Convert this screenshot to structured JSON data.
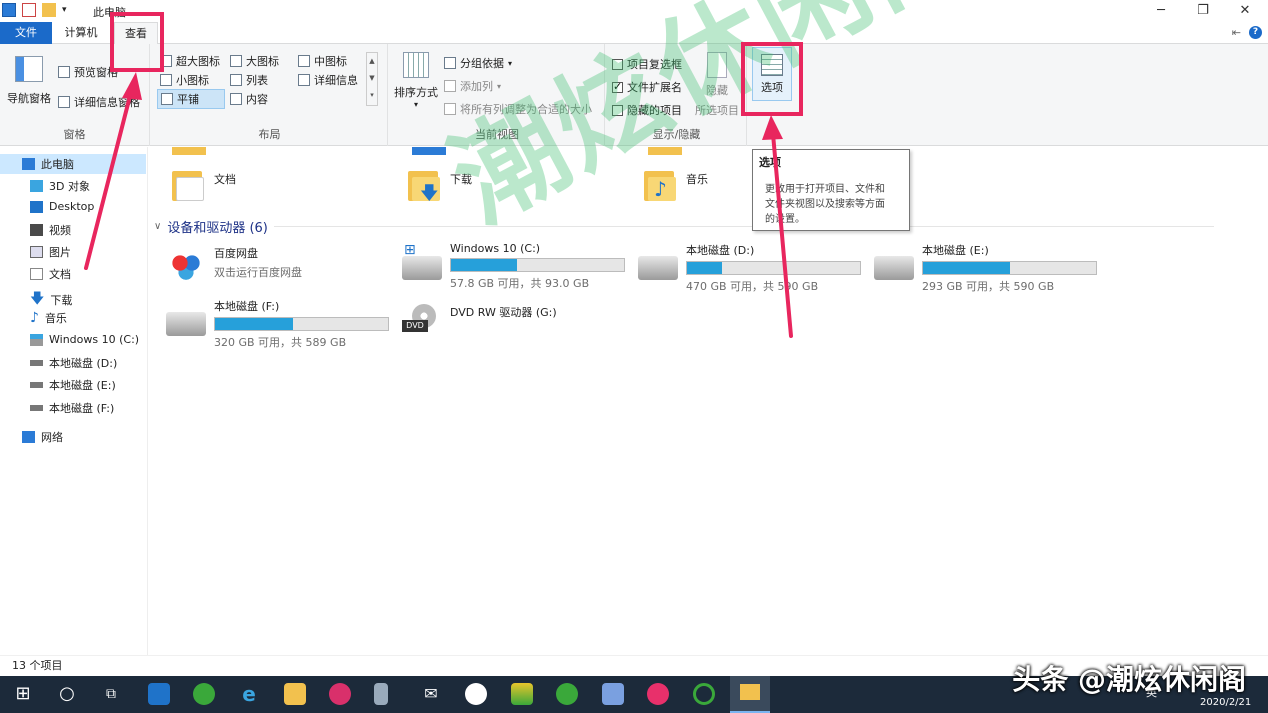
{
  "window": {
    "title": "此电脑",
    "controls": {
      "minimize": "─",
      "maximize": "❐",
      "close": "✕"
    }
  },
  "tabs": {
    "file": "文件",
    "computer": "计算机",
    "view": "查看"
  },
  "ribbon": {
    "pane": {
      "nav_pane": "导航窗格",
      "preview_pane": "预览窗格",
      "details_pane": "详细信息窗格",
      "label": "窗格"
    },
    "layout": {
      "extra_large": "超大图标",
      "large": "大图标",
      "medium": "中图标",
      "small": "小图标",
      "list": "列表",
      "details": "详细信息",
      "tiles": "平铺",
      "content": "内容",
      "label": "布局"
    },
    "current_view": {
      "sort_by": "排序方式",
      "group_by": "分组依据",
      "add_columns": "添加列",
      "size_all": "将所有列调整为合适的大小",
      "label": "当前视图"
    },
    "show_hide": {
      "item_checkboxes": "项目复选框",
      "file_extensions": "文件扩展名",
      "hidden_items": "隐藏的项目",
      "hide_selected": "隐藏",
      "hide_selected_sub": "所选项目",
      "label": "显示/隐藏"
    },
    "options": "选项"
  },
  "tooltip": {
    "title": "选项",
    "line1": "更改用于打开项目、文件和",
    "line2": "文件夹视图以及搜索等方面",
    "line3": "的设置。"
  },
  "nav": {
    "this_pc": "此电脑",
    "objects3d": "3D 对象",
    "desktop": "Desktop",
    "videos": "视频",
    "pictures": "图片",
    "documents": "文档",
    "downloads": "下载",
    "music": "音乐",
    "win10": "Windows 10 (C:)",
    "disk_d": "本地磁盘 (D:)",
    "disk_e": "本地磁盘 (E:)",
    "disk_f": "本地磁盘 (F:)",
    "network": "网络"
  },
  "folders": {
    "documents": "文档",
    "downloads": "下载",
    "music": "音乐"
  },
  "devices_header": "设备和驱动器 (6)",
  "drives": [
    {
      "name": "百度网盘",
      "sub": "双击运行百度网盘"
    },
    {
      "name": "Windows 10 (C:)",
      "free": "57.8 GB 可用，共 93.0 GB",
      "used_fraction": 0.38
    },
    {
      "name": "本地磁盘 (D:)",
      "free": "470 GB 可用，共 590 GB",
      "used_fraction": 0.2
    },
    {
      "name": "本地磁盘 (E:)",
      "free": "293 GB 可用，共 590 GB",
      "used_fraction": 0.5
    },
    {
      "name": "本地磁盘 (F:)",
      "free": "320 GB 可用，共 589 GB",
      "used_fraction": 0.45
    },
    {
      "name": "DVD RW 驱动器 (G:)"
    }
  ],
  "status": "13 个项目",
  "taskbar": {
    "ime": "英",
    "date": "2020/2/21"
  },
  "watermark": "潮炫休闲阁",
  "corner_mark": "头条 @潮炫休闲阁",
  "colors": {
    "accent": "#1b6ac9",
    "annotation": "#e8265e",
    "drive_bar": "#26a0da"
  }
}
